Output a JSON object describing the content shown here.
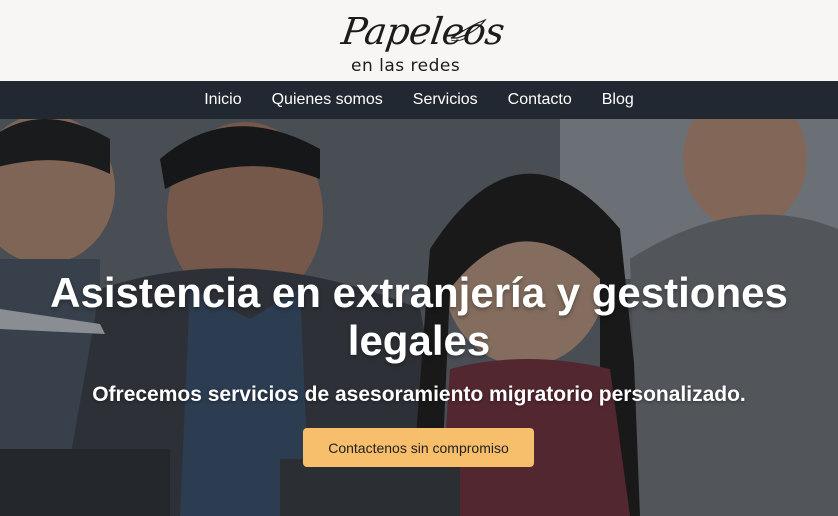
{
  "logo": {
    "script_text": "Papeleos",
    "sub_text": "en las redes"
  },
  "nav": {
    "items": [
      {
        "label": "Inicio"
      },
      {
        "label": "Quienes somos"
      },
      {
        "label": "Servicios"
      },
      {
        "label": "Contacto"
      },
      {
        "label": "Blog"
      }
    ]
  },
  "hero": {
    "title": "Asistencia en extranjería y gestiones legales",
    "subtitle": "Ofrecemos servicios de asesoramiento migratorio personalizado.",
    "cta_label": "Contactenos sin compromiso",
    "cta_color": "#f7be6b"
  },
  "colors": {
    "navbar_bg": "#212831",
    "header_bg": "#f7f6f4",
    "text_light": "#ffffff"
  }
}
